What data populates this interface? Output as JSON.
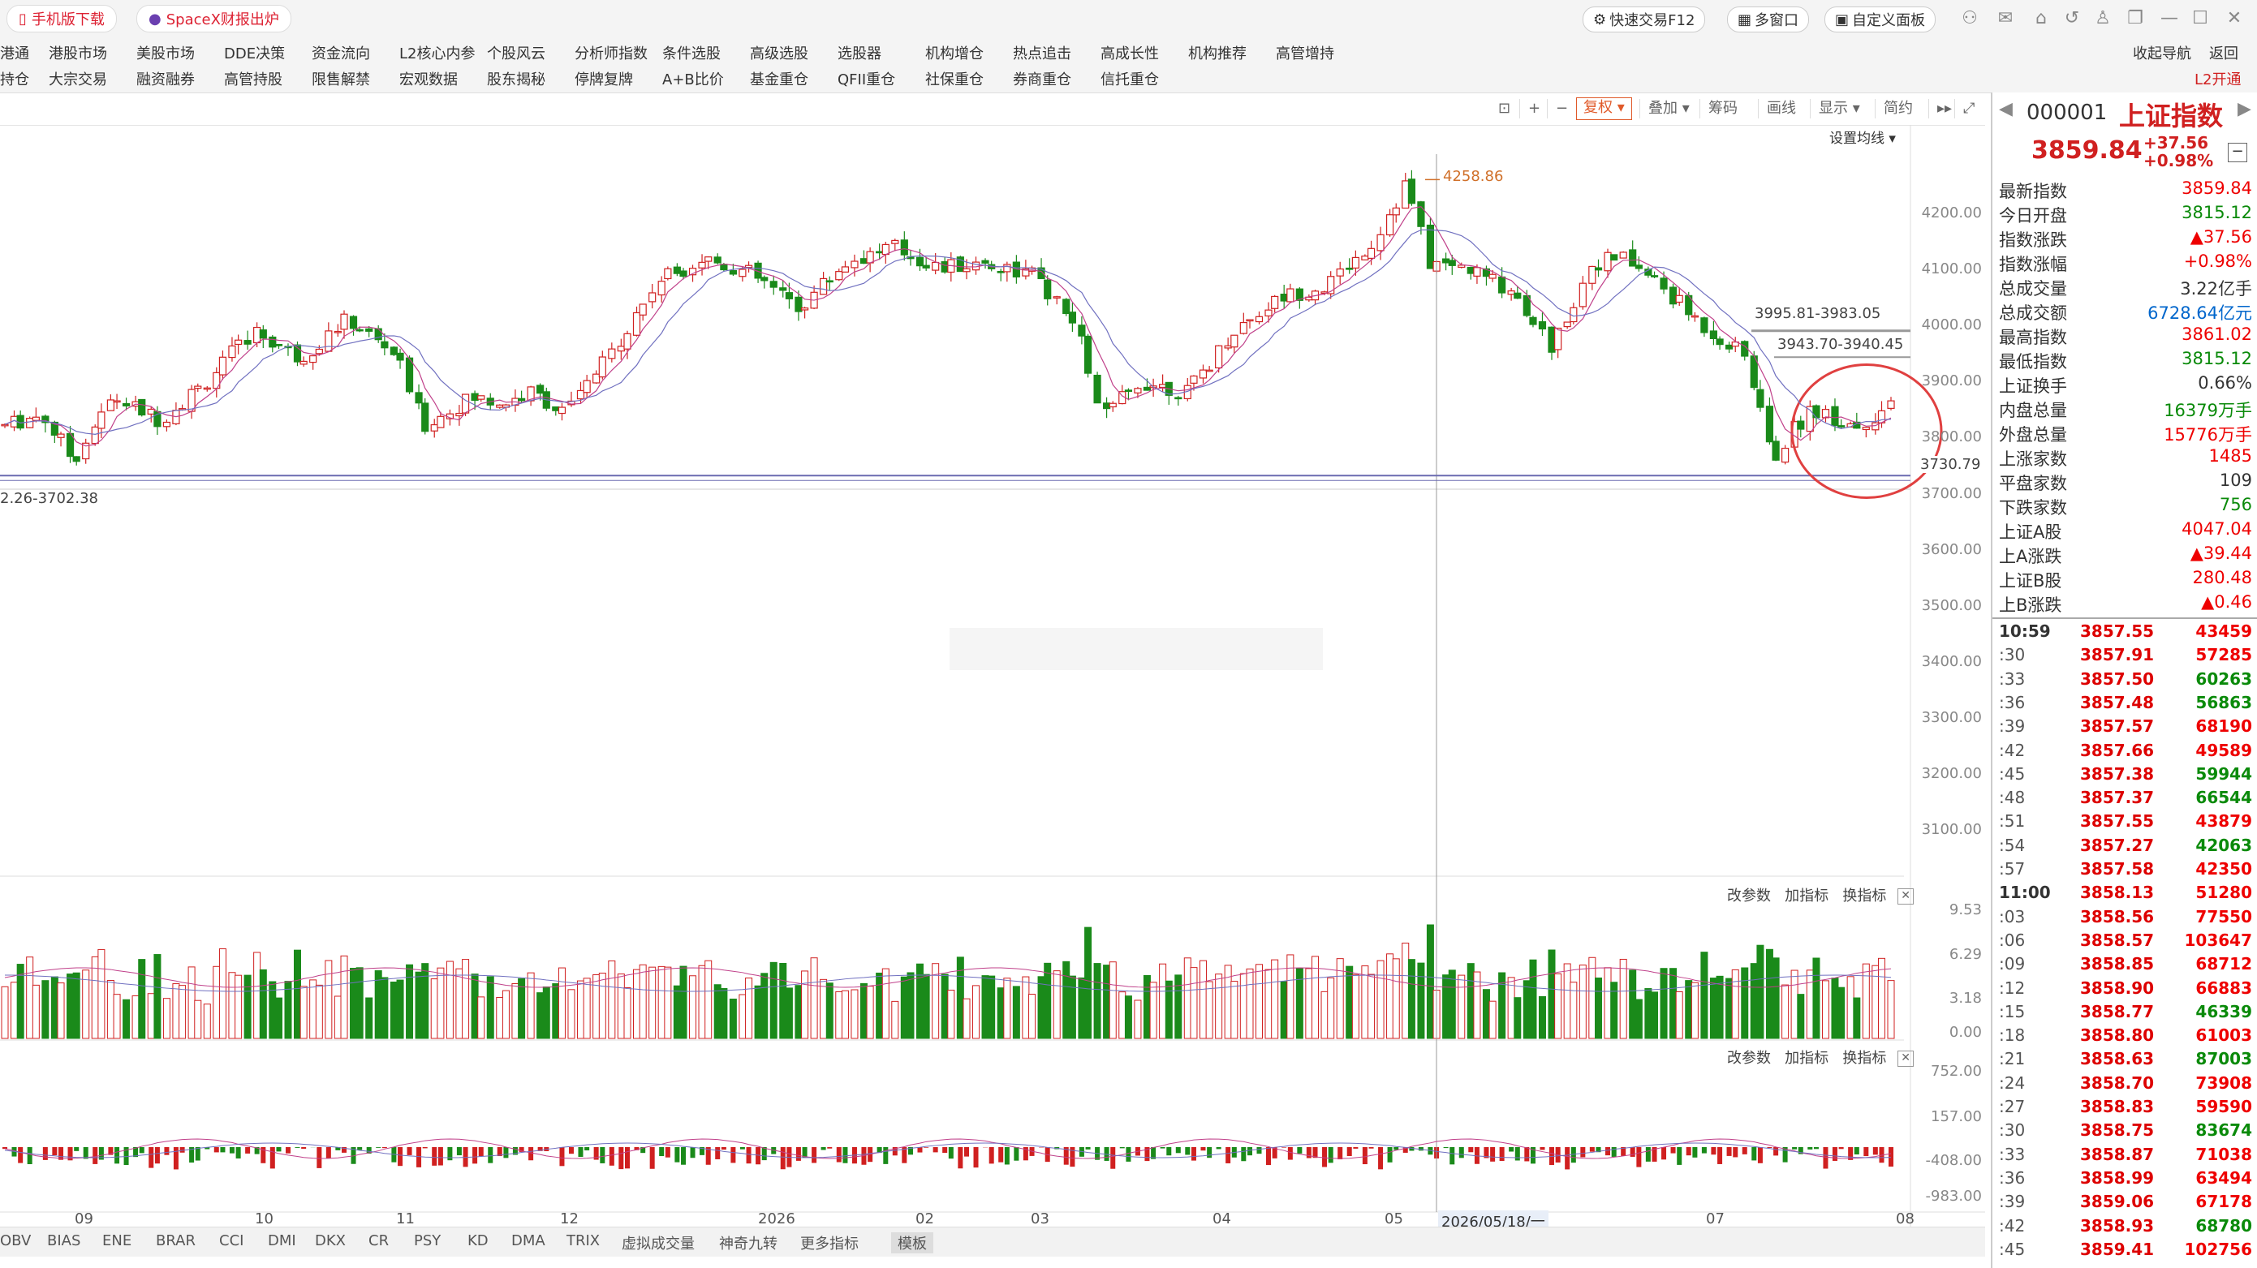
{
  "titlebar": {
    "mobile_download": "手机版下载",
    "spacex_news": "SpaceX财报出炉",
    "quick_trade": "快速交易F12",
    "multi_window": "多窗口",
    "custom_panel": "自定义面板"
  },
  "menu": {
    "row1": [
      "港通",
      "港股市场",
      "美股市场",
      "DDE决策",
      "资金流向",
      "L2核心内参",
      "个股风云",
      "分析师指数",
      "条件选股",
      "高级选股",
      "选股器",
      "机构增仓",
      "热点追击",
      "高成长性",
      "机构推荐",
      "高管增持"
    ],
    "row2": [
      "持仓",
      "大宗交易",
      "融资融券",
      "高管持股",
      "限售解禁",
      "宏观数据",
      "股东揭秘",
      "停牌复牌",
      "A+B比价",
      "基金重仓",
      "QFII重仓",
      "社保重仓",
      "券商重仓",
      "信托重仓"
    ],
    "nav": "收起导航",
    "back": "返回",
    "l2_open": "L2开通"
  },
  "toolbar": {
    "fuquan": "复权",
    "overlay": "叠加",
    "chips": "筹码",
    "draw": "画线",
    "display": "显示",
    "simple": "简约",
    "ma_settings": "设置均线"
  },
  "price_axis": [
    "4200.00",
    "4100.00",
    "4000.00",
    "3900.00",
    "3800.00",
    "3700.00",
    "3600.00",
    "3500.00",
    "3400.00",
    "3300.00",
    "3200.00",
    "3100.00"
  ],
  "chart_annotations": {
    "high_label": "4258.86",
    "range1": "3995.81-3983.05",
    "range2": "3943.70-3940.45",
    "low_line": "3730.79",
    "left_range": "2.26-3702.38",
    "date_cursor": "2026/05/18/一"
  },
  "volume_panel": {
    "buttons": [
      "改参数",
      "加指标",
      "换指标"
    ],
    "axis": [
      "9.53",
      "6.29",
      "3.18",
      "0.00"
    ]
  },
  "macd_panel": {
    "buttons": [
      "改参数",
      "加指标",
      "换指标"
    ],
    "axis": [
      "752.00",
      "157.00",
      "-408.00",
      "-983.00"
    ]
  },
  "x_axis": [
    "09",
    "10",
    "11",
    "12",
    "2026",
    "02",
    "03",
    "04",
    "05",
    "07",
    "08"
  ],
  "bottom_tabs": [
    "OBV",
    "BIAS",
    "ENE",
    "BRAR",
    "CCI",
    "DMI",
    "DKX",
    "CR",
    "PSY",
    "KD",
    "DMA",
    "TRIX",
    "虚拟成交量",
    "神奇九转",
    "更多指标",
    "模板"
  ],
  "quote": {
    "code": "000001",
    "name": "上证指数",
    "price": "3859.84",
    "change": "+37.56",
    "change_pct": "+0.98%",
    "rows": [
      {
        "k": "最新指数",
        "v": "3859.84",
        "c": "red"
      },
      {
        "k": "今日开盘",
        "v": "3815.12",
        "c": "green"
      },
      {
        "k": "指数涨跌",
        "v": "▲37.56",
        "c": "red"
      },
      {
        "k": "指数涨幅",
        "v": "+0.98%",
        "c": "red"
      },
      {
        "k": "总成交量",
        "v": "3.22亿手",
        "c": "black"
      },
      {
        "k": "总成交额",
        "v": "6728.64亿元",
        "c": "blue"
      },
      {
        "k": "最高指数",
        "v": "3861.02",
        "c": "red"
      },
      {
        "k": "最低指数",
        "v": "3815.12",
        "c": "green"
      },
      {
        "k": "上证换手",
        "v": "0.66%",
        "c": "black"
      },
      {
        "k": "内盘总量",
        "v": "16379万手",
        "c": "green"
      },
      {
        "k": "外盘总量",
        "v": "15776万手",
        "c": "red"
      },
      {
        "k": "上涨家数",
        "v": "1485",
        "c": "red"
      },
      {
        "k": "平盘家数",
        "v": "109",
        "c": "black"
      },
      {
        "k": "下跌家数",
        "v": "756",
        "c": "green"
      },
      {
        "k": "上证A股",
        "v": "4047.04",
        "c": "red"
      },
      {
        "k": "上A涨跌",
        "v": "▲39.44",
        "c": "red"
      },
      {
        "k": "上证B股",
        "v": "280.48",
        "c": "red"
      },
      {
        "k": "上B涨跌",
        "v": "▲0.46",
        "c": "red"
      }
    ],
    "ticks": [
      {
        "t": "10:59",
        "p": "3857.55",
        "v": "43459",
        "c": "red"
      },
      {
        "t": ":30",
        "p": "3857.91",
        "v": "57285",
        "c": "red"
      },
      {
        "t": ":33",
        "p": "3857.50",
        "v": "60263",
        "c": "green"
      },
      {
        "t": ":36",
        "p": "3857.48",
        "v": "56863",
        "c": "green"
      },
      {
        "t": ":39",
        "p": "3857.57",
        "v": "68190",
        "c": "red"
      },
      {
        "t": ":42",
        "p": "3857.66",
        "v": "49589",
        "c": "red"
      },
      {
        "t": ":45",
        "p": "3857.38",
        "v": "59944",
        "c": "green"
      },
      {
        "t": ":48",
        "p": "3857.37",
        "v": "66544",
        "c": "green"
      },
      {
        "t": ":51",
        "p": "3857.55",
        "v": "43879",
        "c": "red"
      },
      {
        "t": ":54",
        "p": "3857.27",
        "v": "42063",
        "c": "green"
      },
      {
        "t": ":57",
        "p": "3857.58",
        "v": "42350",
        "c": "red"
      },
      {
        "t": "11:00",
        "p": "3858.13",
        "v": "51280",
        "c": "red"
      },
      {
        "t": ":03",
        "p": "3858.56",
        "v": "77550",
        "c": "red"
      },
      {
        "t": ":06",
        "p": "3858.57",
        "v": "103647",
        "c": "red"
      },
      {
        "t": ":09",
        "p": "3858.85",
        "v": "68712",
        "c": "red"
      },
      {
        "t": ":12",
        "p": "3858.90",
        "v": "66883",
        "c": "red"
      },
      {
        "t": ":15",
        "p": "3858.77",
        "v": "46339",
        "c": "green"
      },
      {
        "t": ":18",
        "p": "3858.80",
        "v": "61003",
        "c": "red"
      },
      {
        "t": ":21",
        "p": "3858.63",
        "v": "87003",
        "c": "green"
      },
      {
        "t": ":24",
        "p": "3858.70",
        "v": "73908",
        "c": "red"
      },
      {
        "t": ":27",
        "p": "3858.83",
        "v": "59590",
        "c": "red"
      },
      {
        "t": ":30",
        "p": "3858.75",
        "v": "83674",
        "c": "green"
      },
      {
        "t": ":33",
        "p": "3858.87",
        "v": "71038",
        "c": "red"
      },
      {
        "t": ":36",
        "p": "3858.99",
        "v": "63494",
        "c": "red"
      },
      {
        "t": ":39",
        "p": "3859.06",
        "v": "67178",
        "c": "red"
      },
      {
        "t": ":42",
        "p": "3858.93",
        "v": "68780",
        "c": "green"
      },
      {
        "t": ":45",
        "p": "3859.41",
        "v": "102756",
        "c": "red"
      }
    ]
  },
  "colors": {
    "up": "#e02020",
    "down": "#1a8a1a",
    "accent": "#d02020"
  },
  "chart_data": {
    "type": "candlestick",
    "price_range": [
      3100,
      4258.86
    ],
    "high": 4258.86,
    "low_marker": 3730.79,
    "volume_range": [
      0,
      9.53
    ],
    "macd_range": [
      -983,
      752
    ],
    "x_ticks": [
      "09",
      "10",
      "11",
      "12",
      "2026",
      "02",
      "03",
      "04",
      "05",
      "07",
      "08"
    ]
  }
}
